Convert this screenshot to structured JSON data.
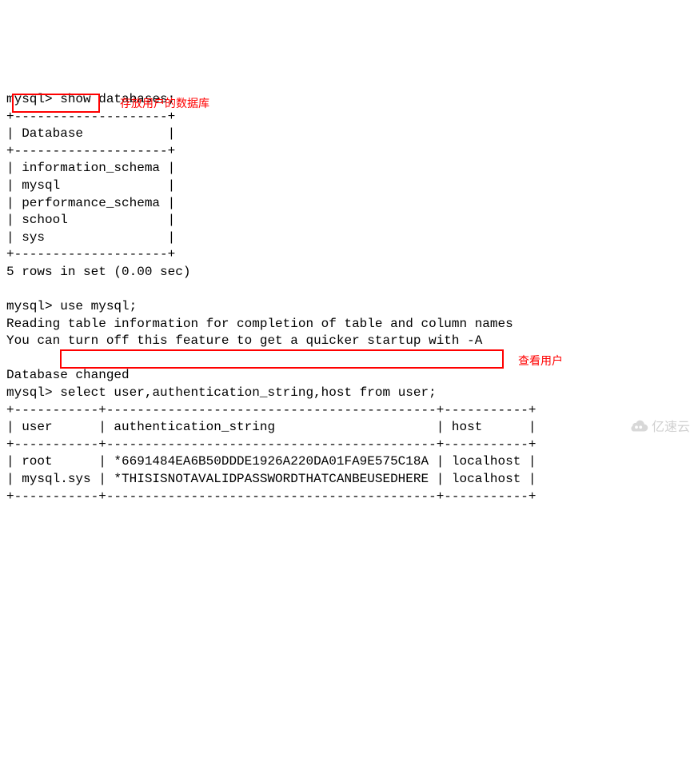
{
  "cmd1": {
    "prompt": "mysql>",
    "query": "show databases;",
    "border_top": "+--------------------+",
    "header_line": "| Database           |",
    "rows": [
      "| information_schema |",
      "| mysql              |",
      "| performance_schema |",
      "| school             |",
      "| sys                |"
    ],
    "border_bottom": "+--------------------+",
    "status": "5 rows in set (0.00 sec)"
  },
  "anno1": "存放用户的数据库",
  "cmd2": {
    "prompt": "mysql>",
    "query": "use mysql;",
    "msg1": "Reading table information for completion of table and column names",
    "msg2": "You can turn off this feature to get a quicker startup with -A",
    "changed": "Database changed"
  },
  "cmd3": {
    "prompt": "mysql>",
    "query": "select user,authentication_string,host from user;",
    "border": "+-----------+-------------------------------------------+-----------+",
    "header": "| user      | authentication_string                     | host      |",
    "rows": [
      "| root      | *6691484EA6B50DDDE1926A220DA01FA9E575C18A | localhost |",
      "| mysql.sys | *THISISNOTAVALIDPASSWORDTHATCANBEUSEDHERE | localhost |"
    ]
  },
  "anno2": "查看用户",
  "watermark": "亿速云"
}
